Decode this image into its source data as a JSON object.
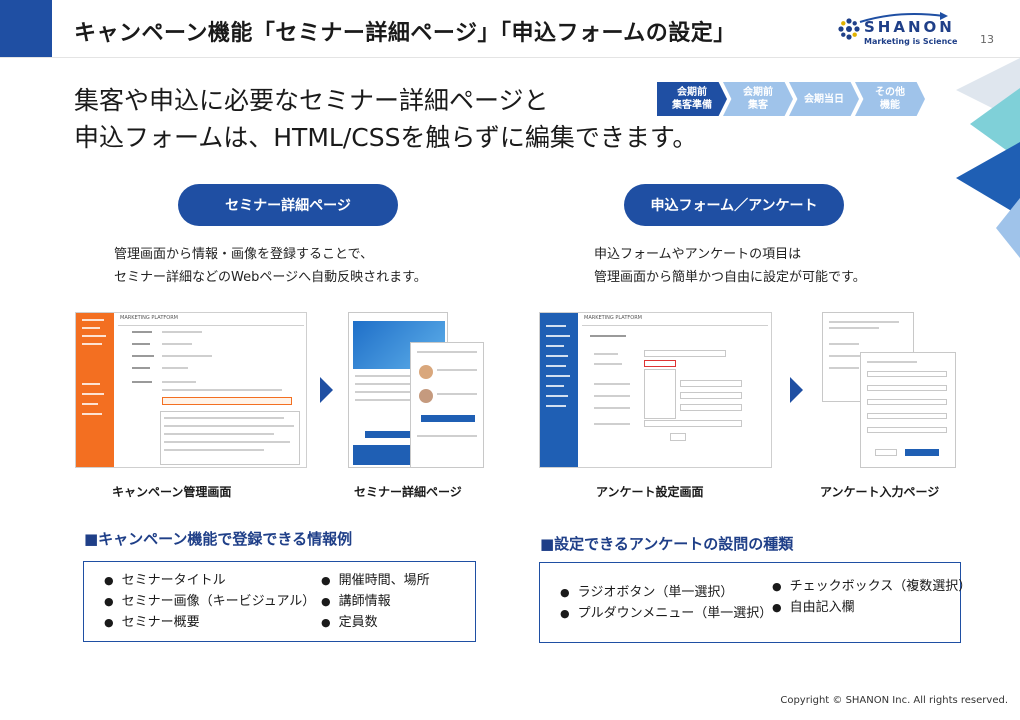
{
  "header": {
    "title": "キャンペーン機能「セミナー詳細ページ」「申込フォームの設定」",
    "page_number": "13"
  },
  "logo": {
    "name": "SHANON",
    "tagline": "Marketing is Science",
    "icon": "shanon-logo-icon"
  },
  "lead": {
    "line1": "集客や申込に必要なセミナー詳細ページと",
    "line2": "申込フォームは、HTML/CSSを触らずに編集できます。"
  },
  "steps": [
    {
      "label": "会期前\n集客準備",
      "active": true
    },
    {
      "label": "会期前\n集客",
      "active": false
    },
    {
      "label": "会期当日",
      "active": false
    },
    {
      "label": "その他\n機能",
      "active": false
    }
  ],
  "left_section": {
    "pill": "セミナー詳細ページ",
    "desc_line1": "管理画面から情報・画像を登録することで、",
    "desc_line2": "セミナー詳細などのWebページへ自動反映されます。",
    "caption1": "キャンペーン管理画面",
    "caption2": "セミナー詳細ページ",
    "heading": "■キャンペーン機能で登録できる情報例",
    "list_col1": [
      "セミナータイトル",
      "セミナー画像（キービジュアル）",
      "セミナー概要"
    ],
    "list_col2": [
      "開催時間、場所",
      "講師情報",
      "定員数"
    ]
  },
  "right_section": {
    "pill": "申込フォーム／アンケート",
    "desc_line1": "申込フォームやアンケートの項目は",
    "desc_line2": "管理画面から簡単かつ自由に設定が可能です。",
    "caption1": "アンケート設定画面",
    "caption2": "アンケート入力ページ",
    "heading": "■設定できるアンケートの設問の種類",
    "list_col1": [
      "ラジオボタン（単一選択）",
      "プルダウンメニュー（単一選択）"
    ],
    "list_col2": [
      "チェックボックス（複数選択）",
      "自由記入欄"
    ]
  },
  "screenshots": {
    "brand_text": "MARKETING PLATFORM"
  },
  "colors": {
    "brand_blue": "#1f4fa3",
    "step_inactive": "#9fc3ea",
    "sidebar_orange": "#f36f21"
  },
  "footer": {
    "copyright": "Copyright © SHANON Inc. All rights reserved."
  }
}
